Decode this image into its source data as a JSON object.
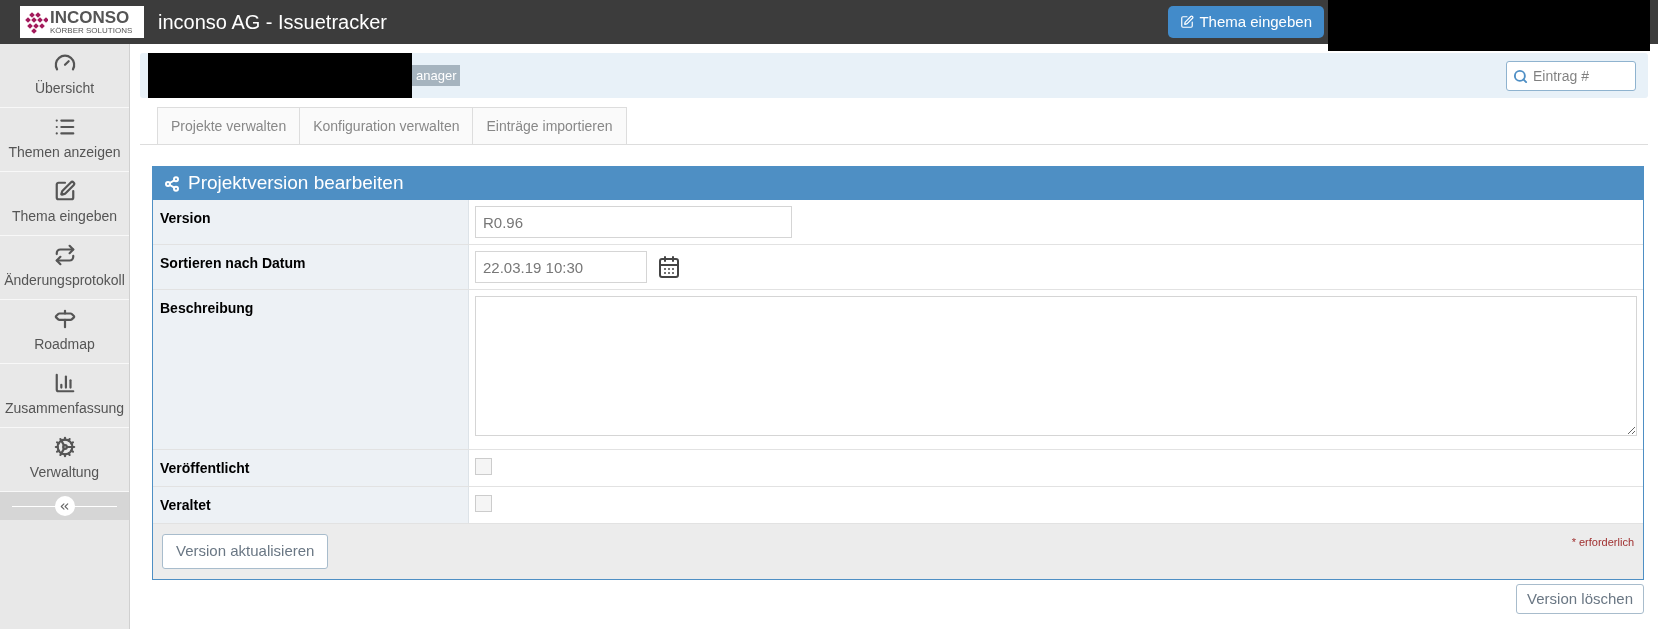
{
  "header": {
    "logo": {
      "word": "INCONSO",
      "tagline": "KÖRBER SOLUTIONS"
    },
    "title": "inconso AG - Issuetracker",
    "action_button": "Thema eingeben"
  },
  "sidebar": {
    "items": [
      {
        "label": "Übersicht"
      },
      {
        "label": "Themen anzeigen"
      },
      {
        "label": "Thema eingeben"
      },
      {
        "label": "Änderungsprotokoll"
      },
      {
        "label": "Roadmap"
      },
      {
        "label": "Zusammenfassung"
      },
      {
        "label": "Verwaltung"
      }
    ]
  },
  "breadcrumb": {
    "badge": "anager",
    "search": {
      "placeholder": "Eintrag #"
    }
  },
  "tabs": [
    {
      "label": "Projekte verwalten"
    },
    {
      "label": "Konfiguration verwalten"
    },
    {
      "label": "Einträge importieren"
    }
  ],
  "panel": {
    "title": "Projektversion bearbeiten",
    "fields": [
      {
        "kind": "text",
        "label": "Version",
        "value": "R0.96"
      },
      {
        "kind": "date",
        "label": "Sortieren nach Datum",
        "value": "22.03.19 10:30"
      },
      {
        "kind": "textarea",
        "label": "Beschreibung"
      },
      {
        "kind": "checkbox",
        "label": "Veröffentlicht",
        "checked": false
      },
      {
        "kind": "checkbox",
        "label": "Veraltet",
        "checked": false
      }
    ],
    "submit": "Version aktualisieren",
    "required_note": "* erforderlich"
  },
  "delete_button": "Version löschen"
}
